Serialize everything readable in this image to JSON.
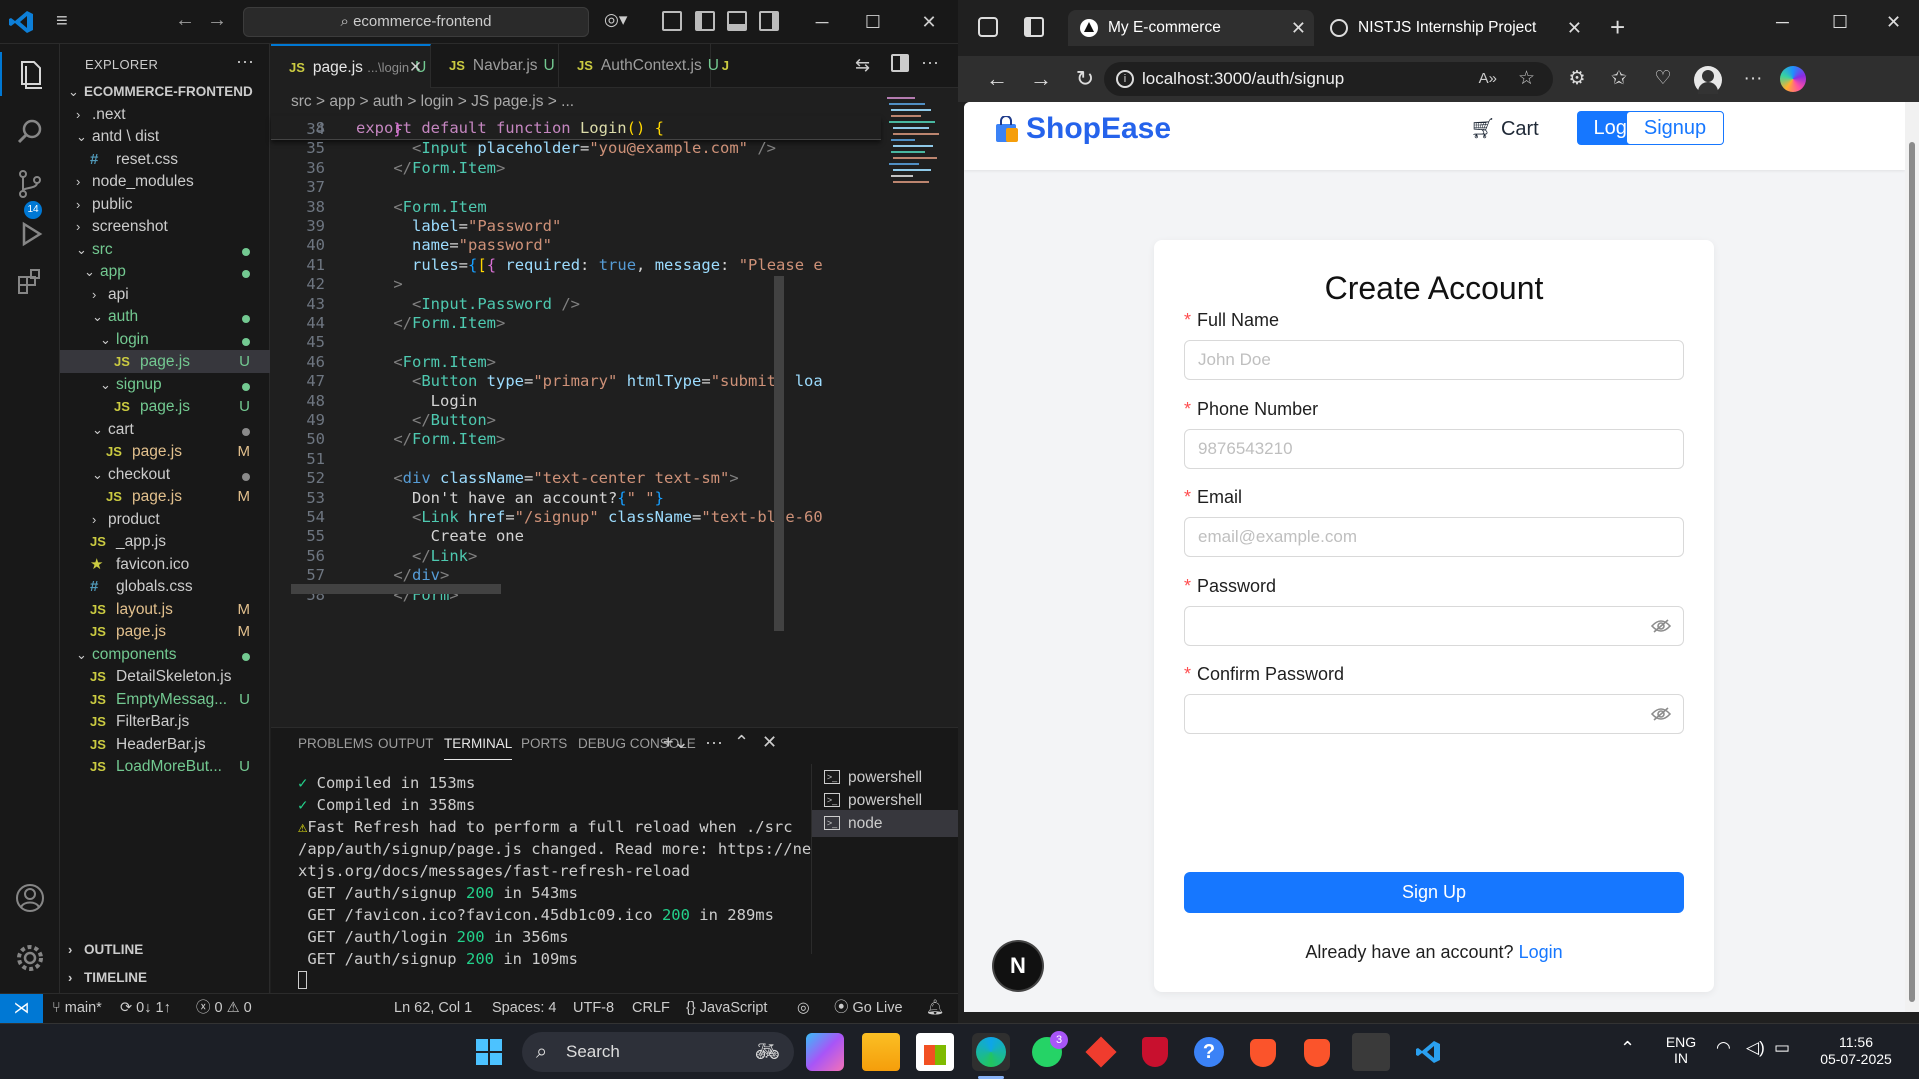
{
  "vscode": {
    "search": "ecommerce-frontend",
    "explorer_title": "EXPLORER",
    "source_control_badge": "14",
    "tree": [
      {
        "label": "ECOMMERCE-FRONTEND",
        "depth": 0,
        "kind": "root",
        "open": true
      },
      {
        "label": ".next",
        "depth": 1,
        "kind": "folder",
        "open": false
      },
      {
        "label": "antd \\ dist",
        "depth": 1,
        "kind": "folder",
        "open": true
      },
      {
        "label": "reset.css",
        "depth": 2,
        "kind": "css"
      },
      {
        "label": "node_modules",
        "depth": 1,
        "kind": "folder",
        "open": false
      },
      {
        "label": "public",
        "depth": 1,
        "kind": "folder",
        "open": false
      },
      {
        "label": "screenshot",
        "depth": 1,
        "kind": "folder",
        "open": false
      },
      {
        "label": "src",
        "depth": 1,
        "kind": "folder",
        "open": true,
        "dot": "#73c991"
      },
      {
        "label": "app",
        "depth": 2,
        "kind": "folder",
        "open": true,
        "dot": "#73c991"
      },
      {
        "label": "api",
        "depth": 3,
        "kind": "folder",
        "open": false
      },
      {
        "label": "auth",
        "depth": 3,
        "kind": "folder",
        "open": true,
        "dot": "#73c991"
      },
      {
        "label": "login",
        "depth": 4,
        "kind": "folder",
        "open": true,
        "dot": "#73c991"
      },
      {
        "label": "page.js",
        "depth": 5,
        "kind": "js",
        "badge": "U",
        "selected": true
      },
      {
        "label": "signup",
        "depth": 4,
        "kind": "folder",
        "open": true,
        "dot": "#73c991"
      },
      {
        "label": "page.js",
        "depth": 5,
        "kind": "js",
        "badge": "U"
      },
      {
        "label": "cart",
        "depth": 3,
        "kind": "folder",
        "open": true,
        "dot": "#8a8a8a"
      },
      {
        "label": "page.js",
        "depth": 4,
        "kind": "js",
        "badge": "M"
      },
      {
        "label": "checkout",
        "depth": 3,
        "kind": "folder",
        "open": true,
        "dot": "#8a8a8a"
      },
      {
        "label": "page.js",
        "depth": 4,
        "kind": "js",
        "badge": "M"
      },
      {
        "label": "product",
        "depth": 3,
        "kind": "folder",
        "open": false
      },
      {
        "label": "_app.js",
        "depth": 2,
        "kind": "js"
      },
      {
        "label": "favicon.ico",
        "depth": 2,
        "kind": "star"
      },
      {
        "label": "globals.css",
        "depth": 2,
        "kind": "css"
      },
      {
        "label": "layout.js",
        "depth": 2,
        "kind": "js",
        "badge": "M"
      },
      {
        "label": "page.js",
        "depth": 2,
        "kind": "js",
        "badge": "M"
      },
      {
        "label": "components",
        "depth": 1,
        "kind": "folder",
        "open": true,
        "dot": "#73c991"
      },
      {
        "label": "DetailSkeleton.js",
        "depth": 2,
        "kind": "js"
      },
      {
        "label": "EmptyMessag...",
        "depth": 2,
        "kind": "js",
        "badge": "U"
      },
      {
        "label": "FilterBar.js",
        "depth": 2,
        "kind": "js"
      },
      {
        "label": "HeaderBar.js",
        "depth": 2,
        "kind": "js"
      },
      {
        "label": "LoadMoreBut...",
        "depth": 2,
        "kind": "js",
        "badge": "U"
      }
    ],
    "outline_label": "OUTLINE",
    "timeline_label": "TIMELINE",
    "tabs": [
      {
        "label": "page.js",
        "hint": "...\\login",
        "badge": "U",
        "active": true
      },
      {
        "label": "Navbar.js",
        "badge": "U"
      },
      {
        "label": "AuthContext.js",
        "badge": "U"
      }
    ],
    "breadcrumb": "src > app > auth > login > JS page.js > ...",
    "sticky_line": {
      "num": "8"
    },
    "line_numbers": [
      "34",
      "35",
      "36",
      "37",
      "38",
      "39",
      "40",
      "41",
      "42",
      "43",
      "44",
      "45",
      "46",
      "47",
      "48",
      "49",
      "50",
      "51",
      "52",
      "53",
      "54",
      "55",
      "56",
      "57",
      "58"
    ],
    "panel_tabs": [
      "PROBLEMS",
      "OUTPUT",
      "TERMINAL",
      "PORTS",
      "DEBUG CONSOLE"
    ],
    "terminal": {
      "line1_mark": "✓",
      "line1": " Compiled in 153ms",
      "line2_mark": "✓",
      "line2": " Compiled in 358ms",
      "line3_mark": "⚠",
      "line3": "Fast Refresh had to perform a full reload when ./src",
      "line4": "/app/auth/signup/page.js changed. Read more: https://ne",
      "line5": "xtjs.org/docs/messages/fast-refresh-reload",
      "requests": [
        {
          "pre": " GET /auth/signup ",
          "code": "200",
          "post": " in 543ms"
        },
        {
          "pre": " GET /favicon.ico?favicon.45db1c09.ico ",
          "code": "200",
          "post": " in 289ms"
        },
        {
          "pre": " GET /auth/login ",
          "code": "200",
          "post": " in 356ms"
        },
        {
          "pre": " GET /auth/signup ",
          "code": "200",
          "post": " in 109ms"
        }
      ]
    },
    "terminal_list": [
      "powershell",
      "powershell",
      "node"
    ],
    "status": {
      "branch": "main*",
      "sync": "⟳ 0↓ 1↑",
      "problems": "ⓧ 0 ⚠ 0",
      "position": "Ln 62, Col 1",
      "spaces": "Spaces: 4",
      "encoding": "UTF-8",
      "eol": "CRLF",
      "language": "{} JavaScript",
      "golive": "Go Live"
    }
  },
  "browser": {
    "tabs": [
      {
        "label": "My E-commerce",
        "active": true
      },
      {
        "label": "NISTJS Internship Project",
        "active": false
      }
    ],
    "url": "localhost:3000/auth/signup",
    "site": {
      "brand": "ShopEase",
      "cart": "Cart",
      "login": "Login",
      "signup": "Signup",
      "title": "Create Account",
      "fields": [
        {
          "label": "Full Name",
          "placeholder": "John Doe",
          "type": "text"
        },
        {
          "label": "Phone Number",
          "placeholder": "9876543210",
          "type": "text"
        },
        {
          "label": "Email",
          "placeholder": "email@example.com",
          "type": "text"
        },
        {
          "label": "Password",
          "placeholder": "",
          "type": "password"
        },
        {
          "label": "Confirm Password",
          "placeholder": "",
          "type": "password"
        }
      ],
      "submit": "Sign Up",
      "already": "Already have an account?",
      "already_link": "Login",
      "next_badge": "N"
    }
  },
  "taskbar": {
    "search": "Search",
    "whatsapp_badge": "3",
    "lang": "ENG",
    "region": "IN",
    "time": "11:56",
    "date": "05-07-2025"
  }
}
